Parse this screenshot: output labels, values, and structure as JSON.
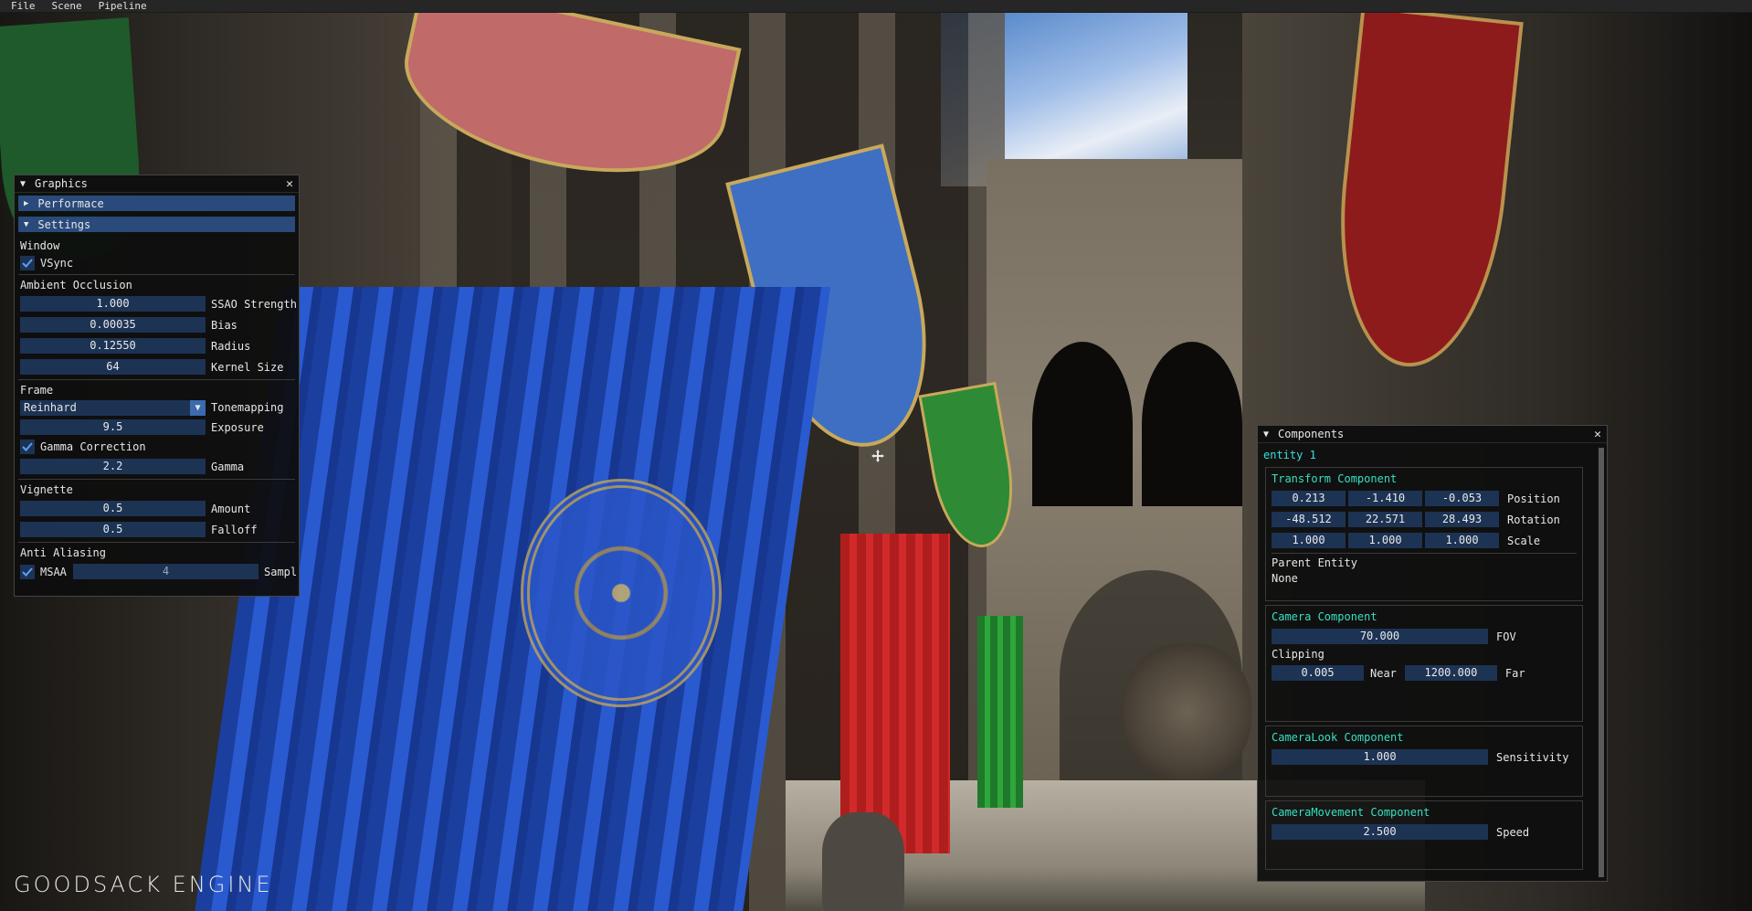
{
  "menu": {
    "items": [
      "File",
      "Scene",
      "Pipeline"
    ]
  },
  "graphics": {
    "title": "Graphics",
    "headers": {
      "performance": "Performace",
      "settings": "Settings"
    },
    "window": {
      "section": "Window",
      "vsync_label": "VSync",
      "vsync": true
    },
    "ao": {
      "section": "Ambient Occlusion",
      "strength": "1.000",
      "strength_label": "SSAO Strength",
      "bias": "0.00035",
      "bias_label": "Bias",
      "radius": "0.12550",
      "radius_label": "Radius",
      "kernel": "64",
      "kernel_label": "Kernel Size"
    },
    "frame": {
      "section": "Frame",
      "tonemapping": "Reinhard",
      "tonemapping_label": "Tonemapping",
      "exposure": "9.5",
      "exposure_label": "Exposure",
      "gamma_correction_label": "Gamma Correction",
      "gamma_correction": true,
      "gamma": "2.2",
      "gamma_label": "Gamma"
    },
    "vignette": {
      "section": "Vignette",
      "amount": "0.5",
      "amount_label": "Amount",
      "falloff": "0.5",
      "falloff_label": "Falloff"
    },
    "aa": {
      "section": "Anti Aliasing",
      "msaa_label": "MSAA",
      "msaa": true,
      "samples": "4",
      "samples_label": "Sampl"
    }
  },
  "components": {
    "title": "Components",
    "entity": "entity 1",
    "transform": {
      "title": "Transform Component",
      "position": [
        "0.213",
        "-1.410",
        "-0.053"
      ],
      "position_label": "Position",
      "rotation": [
        "-48.512",
        "22.571",
        "28.493"
      ],
      "rotation_label": "Rotation",
      "scale": [
        "1.000",
        "1.000",
        "1.000"
      ],
      "scale_label": "Scale",
      "parent_label": "Parent Entity",
      "parent": "None"
    },
    "camera": {
      "title": "Camera Component",
      "fov": "70.000",
      "fov_label": "FOV",
      "clipping_label": "Clipping",
      "near": "0.005",
      "near_label": "Near",
      "far": "1200.000",
      "far_label": "Far"
    },
    "camera_look": {
      "title": "CameraLook Component",
      "sensitivity": "1.000",
      "sensitivity_label": "Sensitivity"
    },
    "camera_movement": {
      "title": "CameraMovement Component",
      "speed": "2.500",
      "speed_label": "Speed"
    }
  },
  "logo": "GOODSACK ENGINE",
  "colors": {
    "accent": "#294a7a",
    "field": "#1d3354",
    "component_title": "#35e0c0",
    "entity": "#35e0e0"
  }
}
